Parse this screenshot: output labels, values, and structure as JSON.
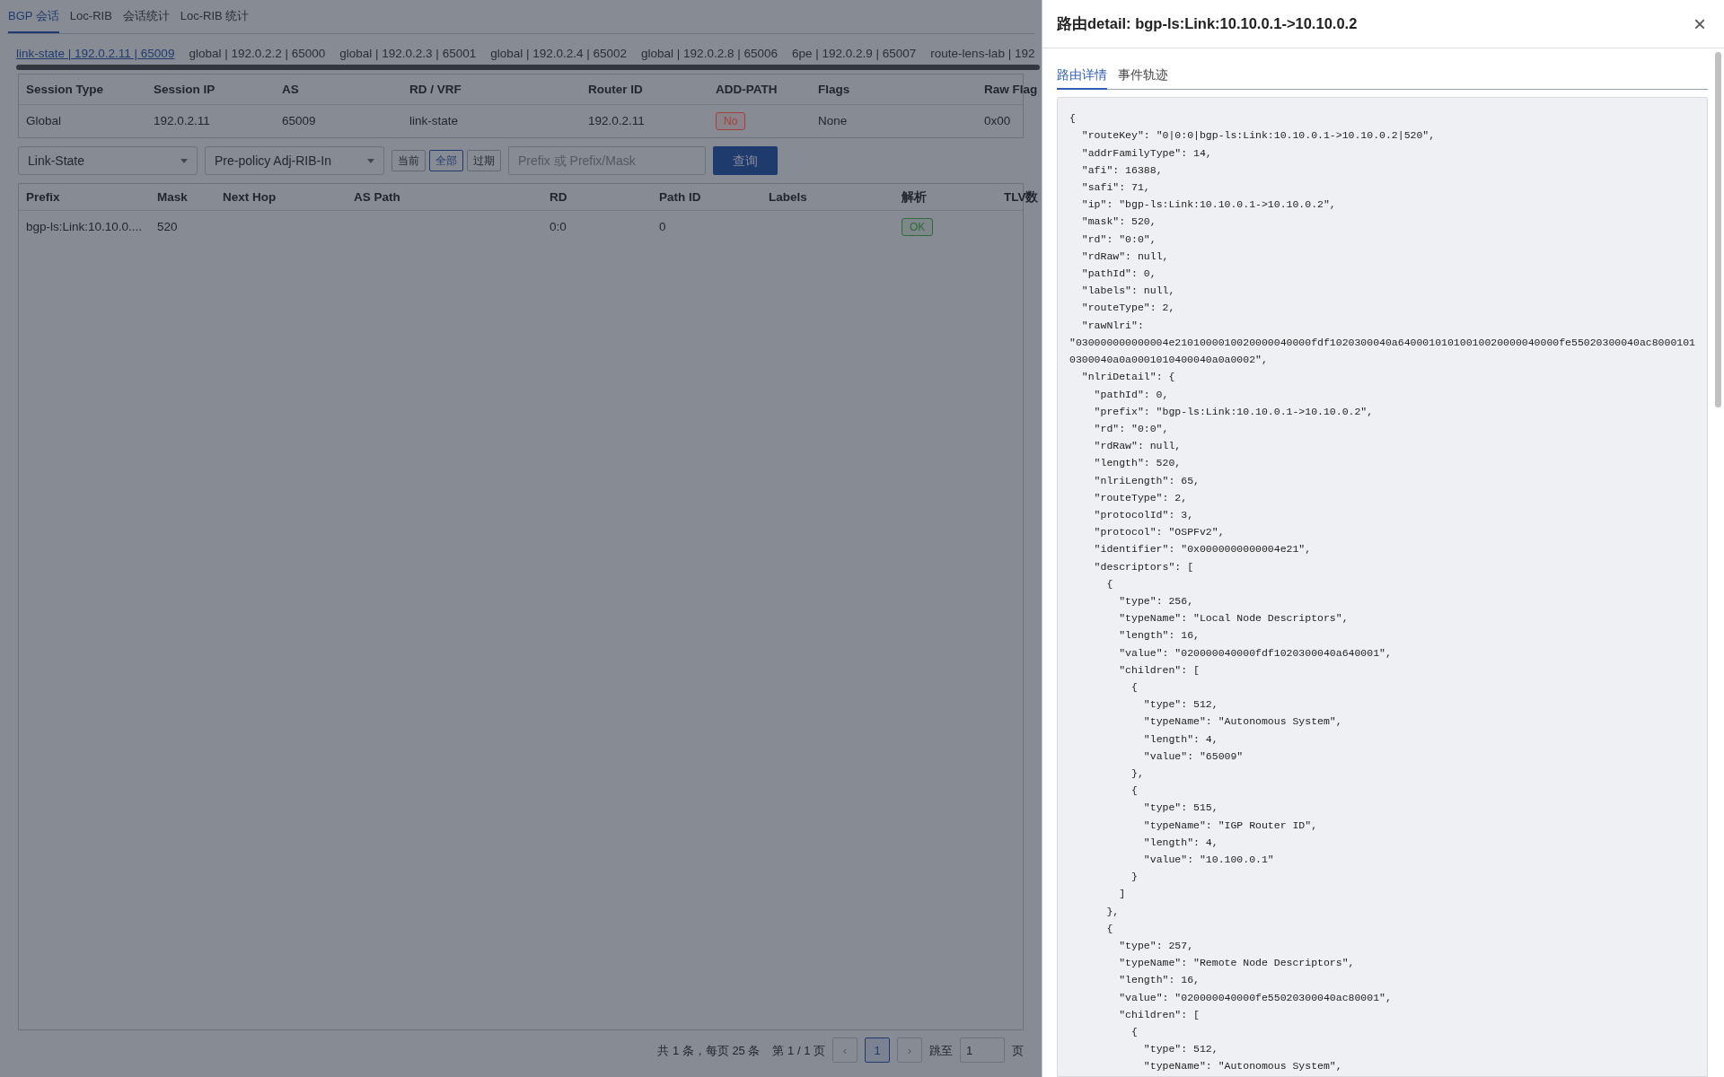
{
  "top_tabs": [
    {
      "label": "BGP 会话",
      "selected": true
    },
    {
      "label": "Loc-RIB",
      "selected": false
    },
    {
      "label": "会话统计",
      "selected": false
    },
    {
      "label": "Loc-RIB 统计",
      "selected": false
    }
  ],
  "session_tabs": [
    {
      "label": "link-state | 192.0.2.11 | 65009",
      "selected": true
    },
    {
      "label": "global | 192.0.2.2 | 65000",
      "selected": false
    },
    {
      "label": "global | 192.0.2.3 | 65001",
      "selected": false
    },
    {
      "label": "global | 192.0.2.4 | 65002",
      "selected": false
    },
    {
      "label": "global | 192.0.2.8 | 65006",
      "selected": false
    },
    {
      "label": "6pe | 192.0.2.9 | 65007",
      "selected": false
    },
    {
      "label": "route-lens-lab | 192",
      "selected": false
    }
  ],
  "session_table": {
    "columns": [
      "Session Type",
      "Session IP",
      "AS",
      "RD / VRF",
      "Router ID",
      "ADD-PATH",
      "Flags",
      "Raw Flag"
    ],
    "rows": [
      {
        "cells": [
          {
            "kind": "text",
            "text": "Global"
          },
          {
            "kind": "text",
            "text": "192.0.2.11"
          },
          {
            "kind": "text",
            "text": "65009"
          },
          {
            "kind": "text",
            "text": "link-state"
          },
          {
            "kind": "text",
            "text": "192.0.2.11"
          },
          {
            "kind": "tag",
            "color": "#a3403c",
            "text": "No"
          },
          {
            "kind": "text",
            "text": "None"
          },
          {
            "kind": "text",
            "text": "0x00"
          }
        ]
      }
    ]
  },
  "filters": {
    "family": {
      "value": "Link-State"
    },
    "rib": {
      "value": "Pre-policy Adj-RIB-In"
    },
    "scope_buttons": [
      {
        "label": "当前",
        "selected": false
      },
      {
        "label": "全部",
        "selected": true
      },
      {
        "label": "过期",
        "selected": false
      }
    ],
    "search": {
      "placeholder": "Prefix 或 Prefix/Mask"
    },
    "query_button": "查询"
  },
  "route_table": {
    "columns": [
      "Prefix",
      "Mask",
      "Next Hop",
      "AS Path",
      "RD",
      "Path ID",
      "Labels",
      "解析",
      "TLV数"
    ],
    "rows": [
      {
        "cells": [
          {
            "kind": "text",
            "text": "bgp-ls:Link:10.10.0...."
          },
          {
            "kind": "text",
            "text": "520"
          },
          {
            "kind": "empty"
          },
          {
            "kind": "empty"
          },
          {
            "kind": "text",
            "text": "0:0"
          },
          {
            "kind": "text",
            "text": "0"
          },
          {
            "kind": "empty"
          },
          {
            "kind": "tag",
            "color": "#2f6a3a",
            "text": "OK"
          }
        ]
      }
    ]
  },
  "pagination": {
    "summary": "共 1 条，每页 25 条",
    "page_info": "第 1 / 1 页",
    "prev": "‹",
    "pages": [
      {
        "label": "1",
        "selected": true
      }
    ],
    "next": "›",
    "jump_label": "跳至",
    "jump_value": "1",
    "jump_suffix": "页"
  },
  "drawer": {
    "title": "路由detail: bgp-ls:Link:10.10.0.1->10.10.0.2",
    "close": "×",
    "tabs": [
      {
        "label": "路由详情",
        "selected": true
      },
      {
        "label": "事件轨迹",
        "selected": false
      }
    ],
    "code": "{\n  \"routeKey\": \"0|0:0|bgp-ls:Link:10.10.0.1->10.10.0.2|520\",\n  \"addrFamilyType\": 14,\n  \"afi\": 16388,\n  \"safi\": 71,\n  \"ip\": \"bgp-ls:Link:10.10.0.1->10.10.0.2\",\n  \"mask\": 520,\n  \"rd\": \"0:0\",\n  \"rdRaw\": null,\n  \"pathId\": 0,\n  \"labels\": null,\n  \"routeType\": 2,\n  \"rawNlri\": \"030000000000004e2101000010020000040000fdf1020300040a64000101010010020000040000fe55020300040ac80001010300040a0a0001010400040a0a0002\",\n  \"nlriDetail\": {\n    \"pathId\": 0,\n    \"prefix\": \"bgp-ls:Link:10.10.0.1->10.10.0.2\",\n    \"rd\": \"0:0\",\n    \"rdRaw\": null,\n    \"length\": 520,\n    \"nlriLength\": 65,\n    \"routeType\": 2,\n    \"protocolId\": 3,\n    \"protocol\": \"OSPFv2\",\n    \"identifier\": \"0x0000000000004e21\",\n    \"descriptors\": [\n      {\n        \"type\": 256,\n        \"typeName\": \"Local Node Descriptors\",\n        \"length\": 16,\n        \"value\": \"020000040000fdf1020300040a640001\",\n        \"children\": [\n          {\n            \"type\": 512,\n            \"typeName\": \"Autonomous System\",\n            \"length\": 4,\n            \"value\": \"65009\"\n          },\n          {\n            \"type\": 515,\n            \"typeName\": \"IGP Router ID\",\n            \"length\": 4,\n            \"value\": \"10.100.0.1\"\n          }\n        ]\n      },\n      {\n        \"type\": 257,\n        \"typeName\": \"Remote Node Descriptors\",\n        \"length\": 16,\n        \"value\": \"020000040000fe55020300040ac80001\",\n        \"children\": [\n          {\n            \"type\": 512,\n            \"typeName\": \"Autonomous System\","
  }
}
